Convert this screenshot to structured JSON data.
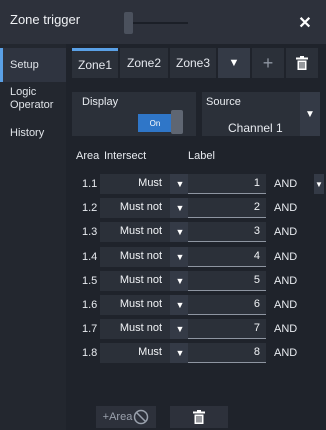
{
  "dialog": {
    "title": "Zone trigger",
    "close_symbol": "✕"
  },
  "sidebar": {
    "items": [
      {
        "label": "Setup",
        "active": true
      },
      {
        "label": "Logic Operator",
        "active": false
      },
      {
        "label": "History",
        "active": false
      }
    ]
  },
  "tabs": {
    "items": [
      {
        "label": "Zone1",
        "active": true
      },
      {
        "label": "Zone2",
        "active": false
      },
      {
        "label": "Zone3",
        "active": false
      }
    ],
    "add_symbol": "+",
    "dropdown_symbol": "▼"
  },
  "display": {
    "label": "Display",
    "toggle_label": "On"
  },
  "source": {
    "label": "Source",
    "value": "Channel 1",
    "dropdown_symbol": "▼"
  },
  "table": {
    "headers": {
      "area": "Area",
      "intersect": "Intersect",
      "label": "Label"
    },
    "rows": [
      {
        "area": "1.1",
        "intersect": "Must",
        "label": "1",
        "operator": "AND",
        "has_op_dropdown": true
      },
      {
        "area": "1.2",
        "intersect": "Must not",
        "label": "2",
        "operator": "AND",
        "has_op_dropdown": false
      },
      {
        "area": "1.3",
        "intersect": "Must not",
        "label": "3",
        "operator": "AND",
        "has_op_dropdown": false
      },
      {
        "area": "1.4",
        "intersect": "Must not",
        "label": "4",
        "operator": "AND",
        "has_op_dropdown": false
      },
      {
        "area": "1.5",
        "intersect": "Must not",
        "label": "5",
        "operator": "AND",
        "has_op_dropdown": false
      },
      {
        "area": "1.6",
        "intersect": "Must not",
        "label": "6",
        "operator": "AND",
        "has_op_dropdown": false
      },
      {
        "area": "1.7",
        "intersect": "Must not",
        "label": "7",
        "operator": "AND",
        "has_op_dropdown": false
      },
      {
        "area": "1.8",
        "intersect": "Must",
        "label": "8",
        "operator": "AND",
        "has_op_dropdown": false
      }
    ]
  },
  "footer": {
    "add_area_label": "+Area"
  },
  "icons": {
    "close": "close-icon",
    "add": "plus-icon",
    "delete": "trash-icon",
    "dropdown": "chevron-down-icon",
    "disabled": "no-entry-icon"
  },
  "colors": {
    "accent": "#5aa0e6",
    "toggle_on": "#2f76c8",
    "background": "#1f232b"
  }
}
